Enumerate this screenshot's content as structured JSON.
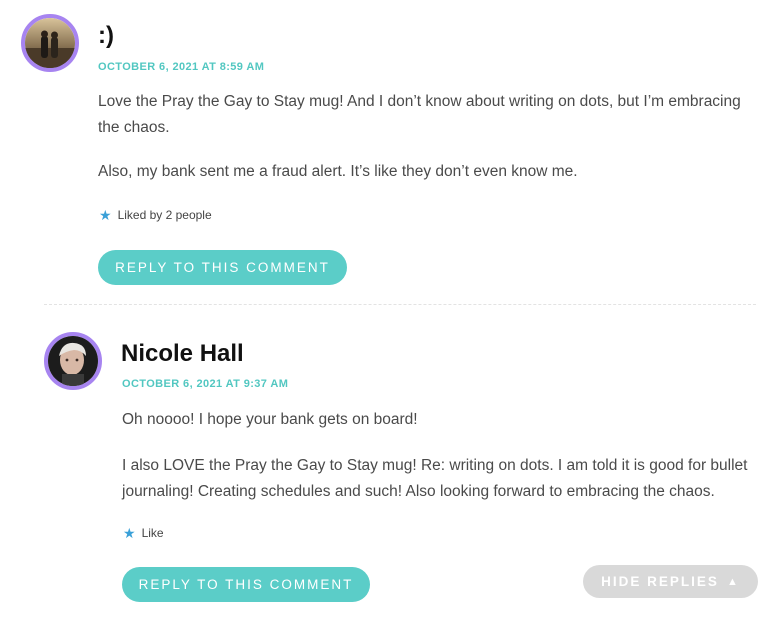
{
  "comments": [
    {
      "author": ":)",
      "date": "OCTOBER 6, 2021 AT 8:59 AM",
      "paragraphs": [
        "Love the Pray the Gay to Stay mug! And I don’t know about writing on dots, but I’m embracing the chaos.",
        "Also, my bank sent me a fraud alert. It’s like they don’t even know me."
      ],
      "like_text": "Liked by 2 people",
      "reply_label": "REPLY TO THIS COMMENT"
    },
    {
      "author": "Nicole Hall",
      "date": "OCTOBER 6, 2021 AT 9:37 AM",
      "paragraphs": [
        "Oh noooo! I hope your bank gets on board!",
        "I also LOVE the Pray the Gay to Stay mug! Re: writing on dots. I am told it is good for bullet journaling! Creating schedules and such! Also looking forward to embracing the chaos."
      ],
      "like_text": "Like",
      "reply_label": "REPLY TO THIS COMMENT"
    }
  ],
  "hide_replies_label": "HIDE REPLIES",
  "icons": {
    "like": "star-icon",
    "hide": "triangle-up-icon"
  },
  "colors": {
    "accent": "#5bcdc8",
    "avatar_ring": "#a784f0",
    "date": "#52c7c1",
    "hide_button": "#d9d9d9",
    "star": "#3aa0d8"
  }
}
